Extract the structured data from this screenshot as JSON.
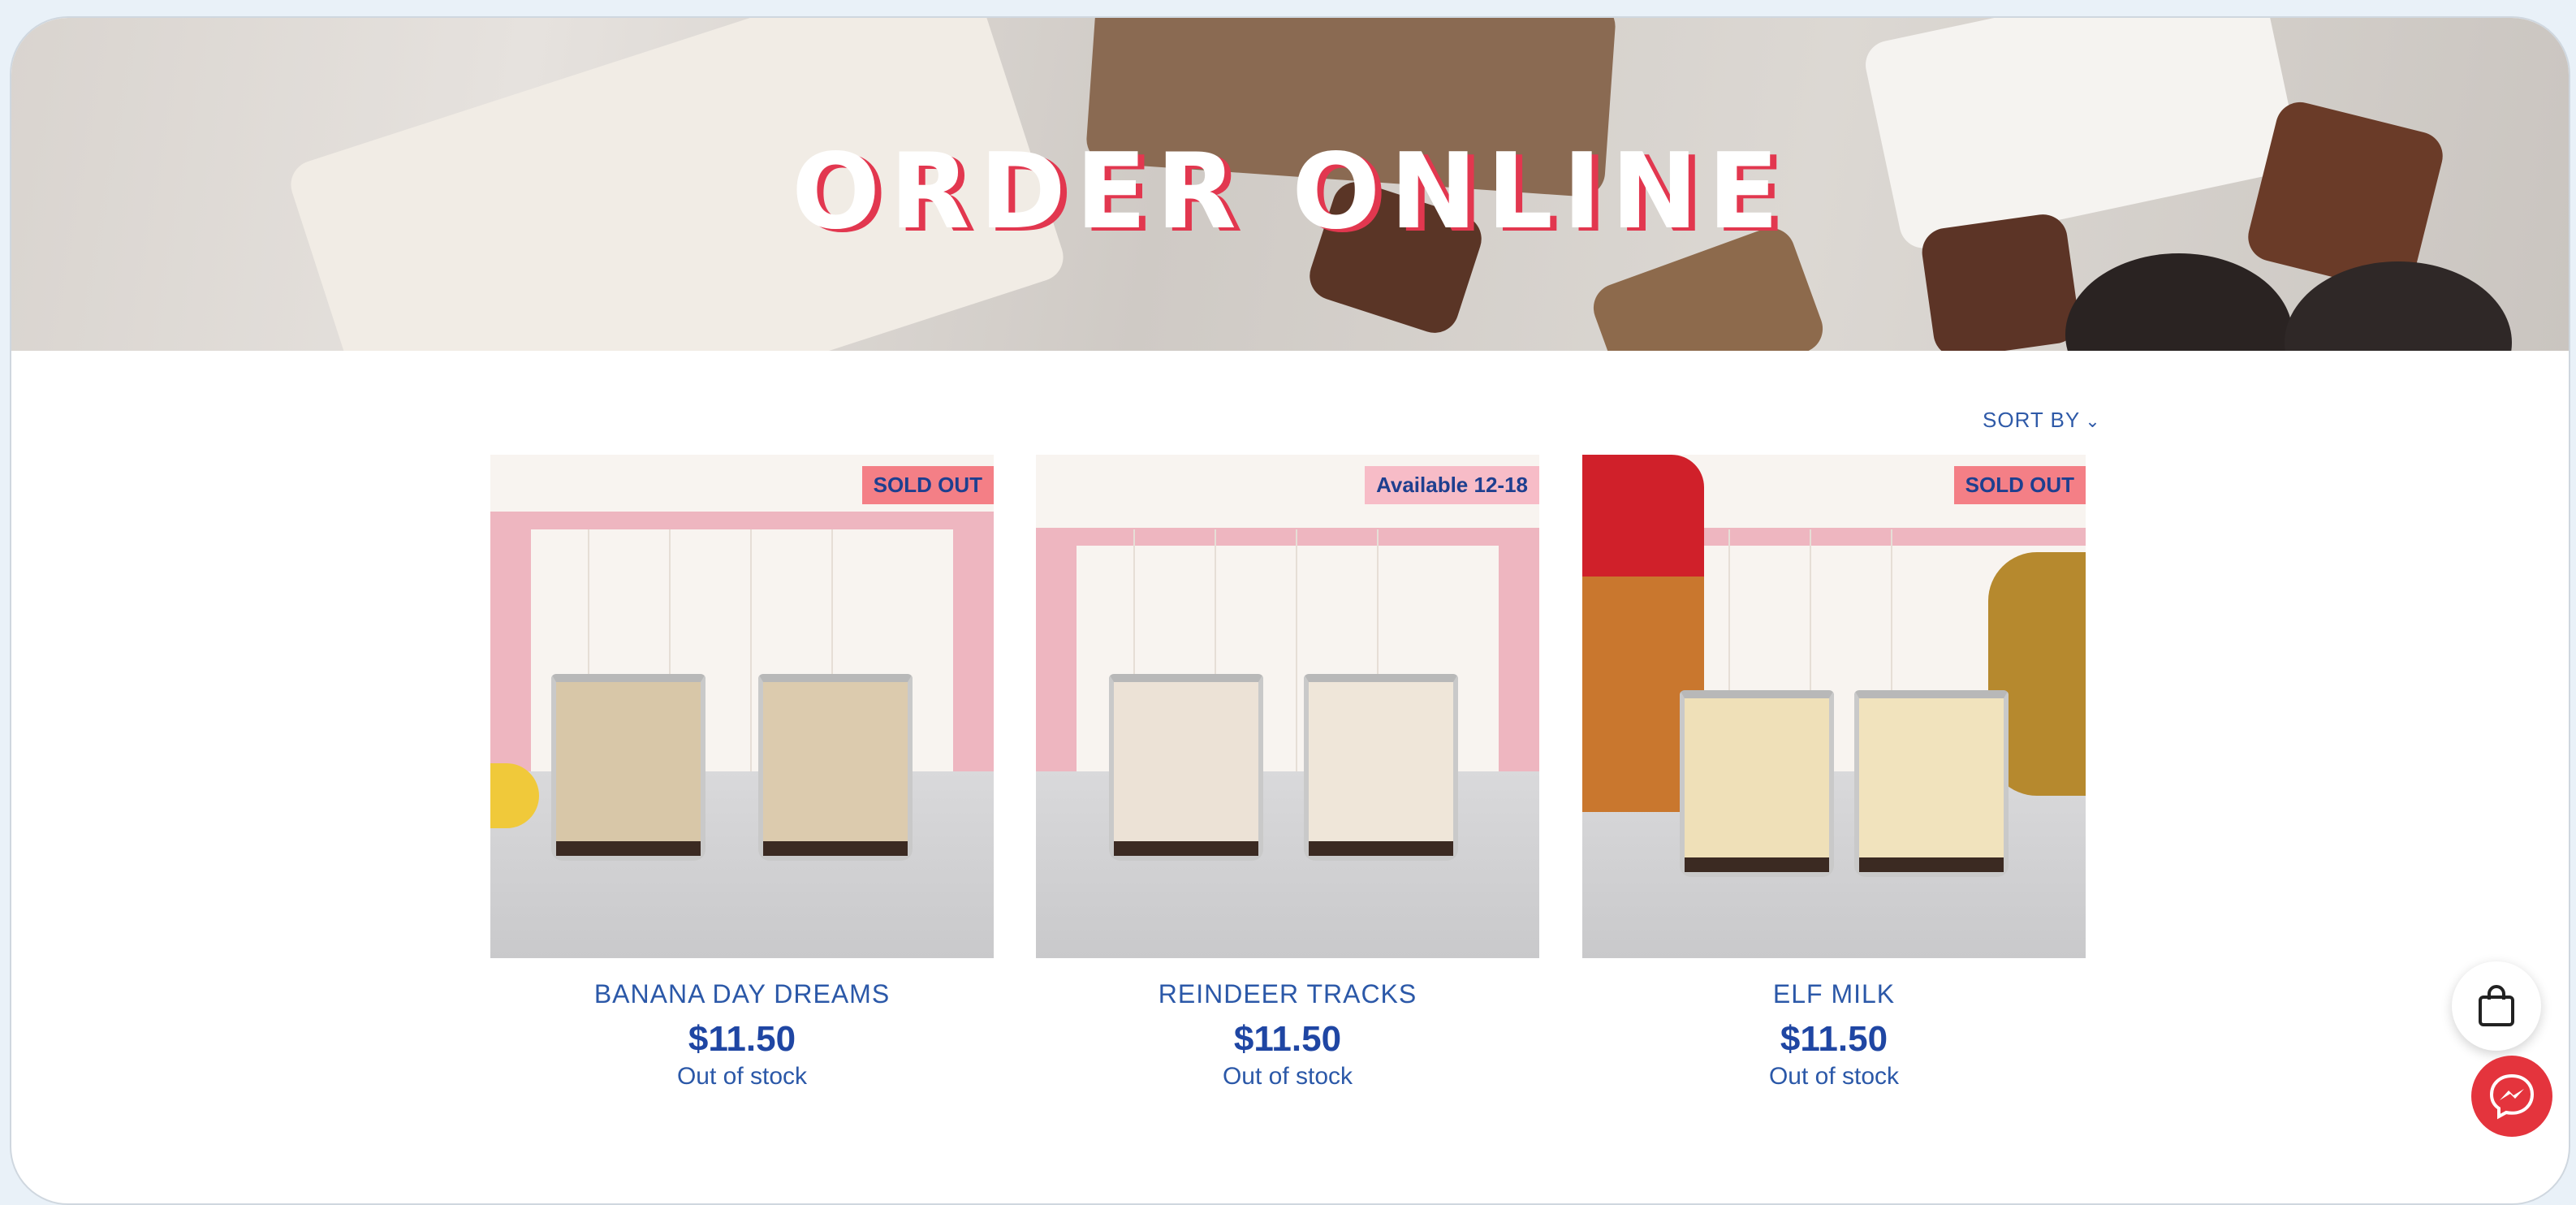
{
  "hero": {
    "title": "ORDER ONLINE"
  },
  "sort": {
    "label": "SORT BY"
  },
  "products": [
    {
      "name": "BANANA DAY DREAMS",
      "price": "$11.50",
      "stock": "Out of stock",
      "badge": "SOLD OUT"
    },
    {
      "name": "REINDEER TRACKS",
      "price": "$11.50",
      "stock": "Out of stock",
      "badge": "Available 12-18"
    },
    {
      "name": "ELF MILK",
      "price": "$11.50",
      "stock": "Out of stock",
      "badge": "SOLD OUT"
    }
  ],
  "icons": {
    "sort": "chevron-down-icon",
    "cart": "shopping-bag-icon",
    "chat": "messenger-icon"
  },
  "colors": {
    "brand_blue": "#2b58a8",
    "badge_red": "#f47f86",
    "badge_pink": "#f7bcc7",
    "chat_red": "#e4343d"
  }
}
